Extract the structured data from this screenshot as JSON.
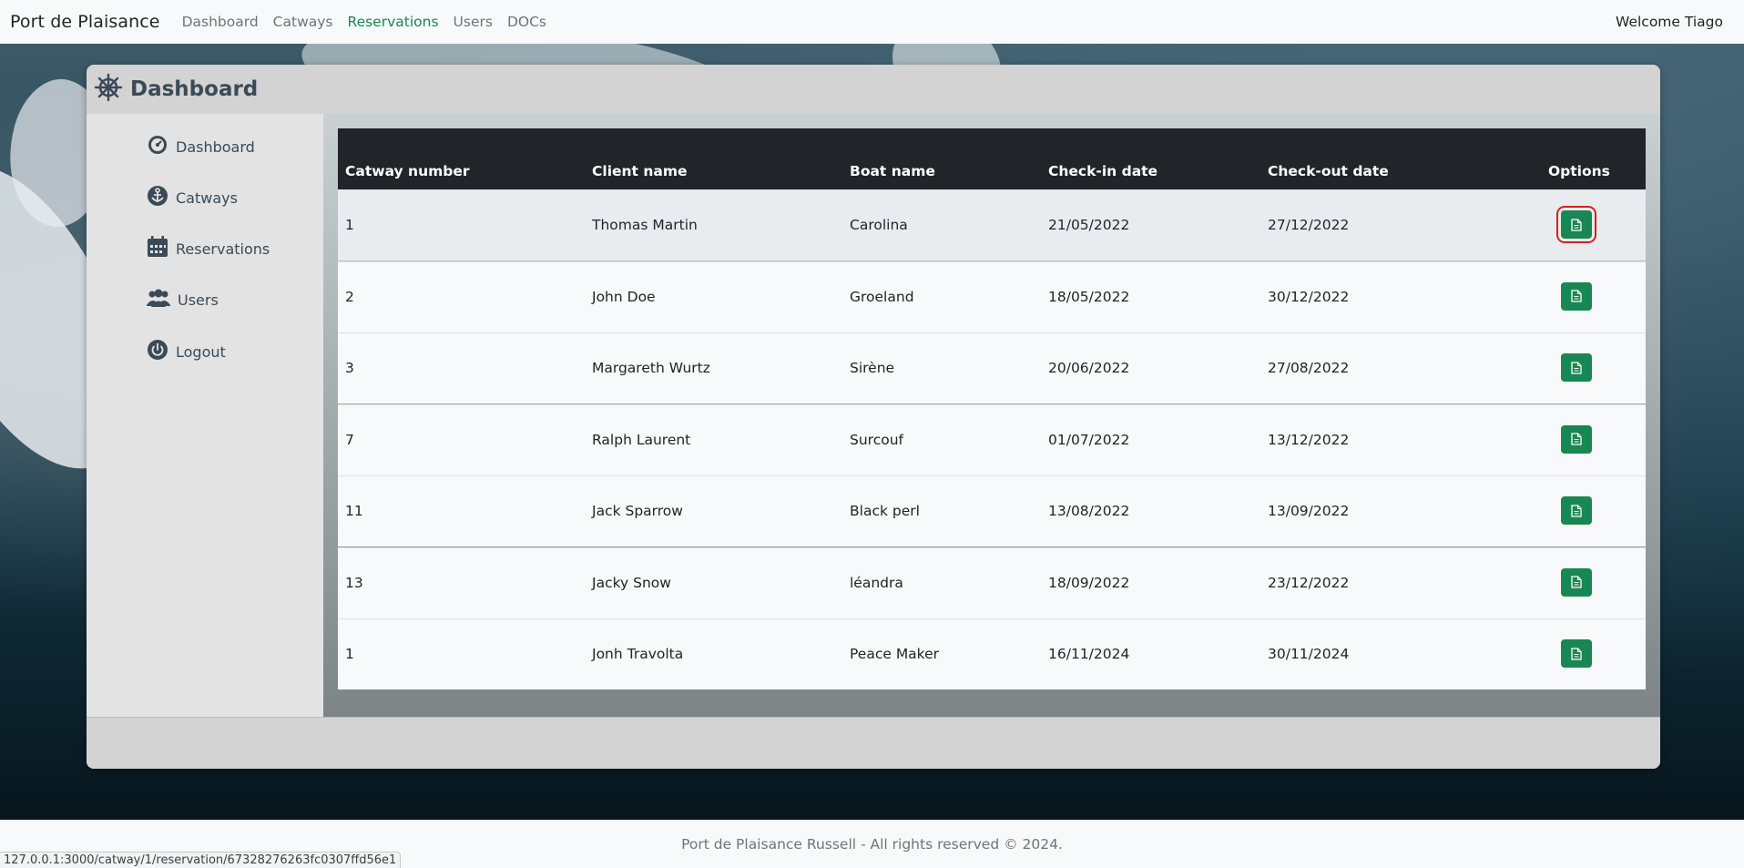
{
  "navbar": {
    "brand": "Port de Plaisance",
    "links": [
      {
        "label": "Dashboard",
        "active": false
      },
      {
        "label": "Catways",
        "active": false
      },
      {
        "label": "Reservations",
        "active": true
      },
      {
        "label": "Users",
        "active": false
      },
      {
        "label": "DOCs",
        "active": false
      }
    ],
    "welcome": "Welcome Tiago"
  },
  "card": {
    "title": "Dashboard",
    "title_icon": "ship-wheel-icon"
  },
  "sidebar": {
    "items": [
      {
        "label": "Dashboard",
        "icon": "gauge-icon"
      },
      {
        "label": "Catways",
        "icon": "anchor-icon"
      },
      {
        "label": "Reservations",
        "icon": "calendar-icon"
      },
      {
        "label": "Users",
        "icon": "users-icon"
      },
      {
        "label": "Logout",
        "icon": "power-icon"
      }
    ]
  },
  "table": {
    "headers": [
      "Catway number",
      "Client name",
      "Boat name",
      "Check-in date",
      "Check-out date",
      "Options"
    ],
    "rows": [
      [
        "1",
        "Thomas Martin",
        "Carolina",
        "21/05/2022",
        "27/12/2022"
      ],
      [
        "2",
        "John Doe",
        "Groeland",
        "18/05/2022",
        "30/12/2022"
      ],
      [
        "3",
        "Margareth Wurtz",
        "Sirène",
        "20/06/2022",
        "27/08/2022"
      ],
      [
        "7",
        "Ralph Laurent",
        "Surcouf",
        "01/07/2022",
        "13/12/2022"
      ],
      [
        "11",
        "Jack Sparrow",
        "Black perl",
        "13/08/2022",
        "13/09/2022"
      ],
      [
        "13",
        "Jacky Snow",
        "léandra",
        "18/09/2022",
        "23/12/2022"
      ],
      [
        "1",
        "Jonh Travolta",
        "Peace Maker",
        "16/11/2024",
        "30/11/2024"
      ]
    ],
    "option_icon": "document-icon",
    "selected_row": 0
  },
  "footer": {
    "text": "Port de Plaisance Russell - All rights reserved © 2024."
  },
  "status_bar": {
    "url": "127.0.0.1:3000/catway/1/reservation/67328276263fc0307ffd56e1"
  },
  "colors": {
    "accent": "#198754",
    "table_header": "#212529",
    "selection_outline": "#d42020"
  }
}
